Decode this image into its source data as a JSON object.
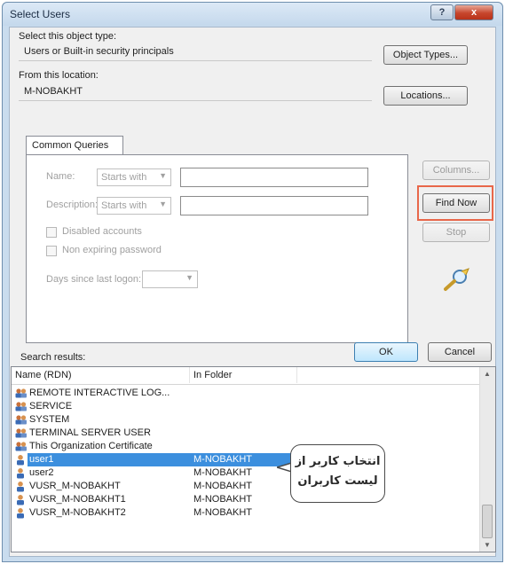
{
  "window": {
    "title": "Select Users",
    "help_label": "?",
    "close_label": "x"
  },
  "object_type": {
    "label": "Select this object type:",
    "value": "Users or Built-in security principals",
    "button": "Object Types..."
  },
  "location": {
    "label": "From this location:",
    "value": "M-NOBAKHT",
    "button": "Locations..."
  },
  "tab": {
    "label": "Common Queries"
  },
  "query": {
    "name_label": "Name:",
    "name_mode": "Starts with",
    "description_label": "Description:",
    "description_mode": "Starts with",
    "disabled_label": "Disabled accounts",
    "nonexpiring_label": "Non expiring password",
    "days_label": "Days since last logon:"
  },
  "side_buttons": {
    "columns": "Columns...",
    "find_now": "Find Now",
    "stop": "Stop"
  },
  "dialog_buttons": {
    "ok": "OK",
    "cancel": "Cancel"
  },
  "results": {
    "label": "Search results:",
    "columns": [
      "Name (RDN)",
      "In Folder"
    ],
    "rows": [
      {
        "name": "REMOTE INTERACTIVE LOG...",
        "folder": "",
        "icon": "group-icon"
      },
      {
        "name": "SERVICE",
        "folder": "",
        "icon": "group-icon"
      },
      {
        "name": "SYSTEM",
        "folder": "",
        "icon": "group-icon"
      },
      {
        "name": "TERMINAL SERVER USER",
        "folder": "",
        "icon": "group-icon"
      },
      {
        "name": "This Organization Certificate",
        "folder": "",
        "icon": "group-icon"
      },
      {
        "name": "user1",
        "folder": "M-NOBAKHT",
        "icon": "user-icon",
        "selected": true
      },
      {
        "name": "user2",
        "folder": "M-NOBAKHT",
        "icon": "user-icon"
      },
      {
        "name": "VUSR_M-NOBAKHT",
        "folder": "M-NOBAKHT",
        "icon": "user-icon"
      },
      {
        "name": "VUSR_M-NOBAKHT1",
        "folder": "M-NOBAKHT",
        "icon": "user-icon"
      },
      {
        "name": "VUSR_M-NOBAKHT2",
        "folder": "M-NOBAKHT",
        "icon": "user-icon"
      }
    ]
  },
  "callout": {
    "line1": "انتخاب کاربر از",
    "line2": "لیست کاربران"
  },
  "colors": {
    "selection": "#3399ff",
    "highlight_border": "#e8674a",
    "title_bar": "#c4d8ec"
  }
}
